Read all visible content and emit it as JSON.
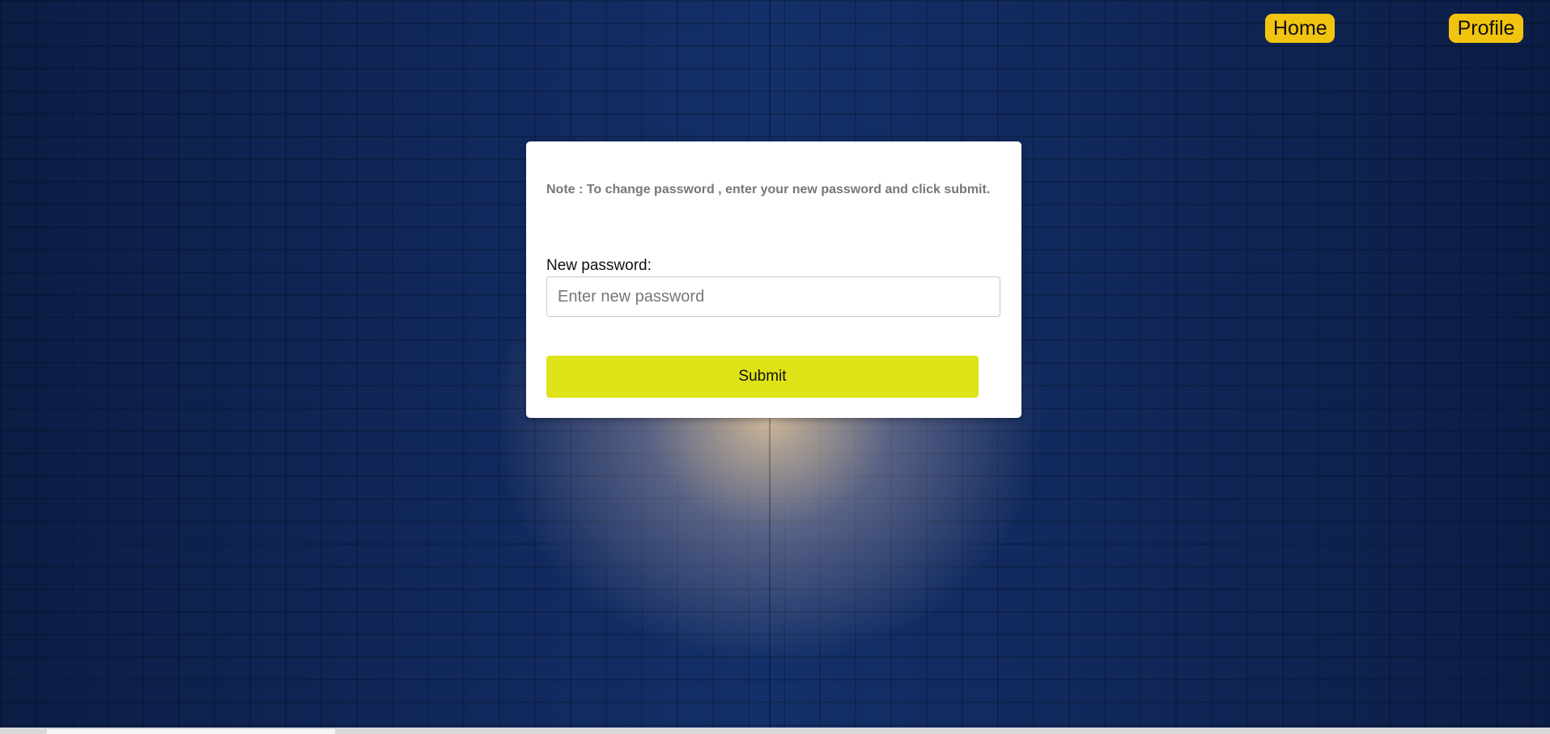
{
  "nav": {
    "home_label": "Home",
    "profile_label": "Profile"
  },
  "form": {
    "note": "Note : To change password , enter your new password and click submit.",
    "new_password_label": "New password:",
    "new_password_placeholder": "Enter new password",
    "new_password_value": "",
    "submit_label": "Submit"
  },
  "colors": {
    "nav_button": "#f1c40f",
    "submit_button": "#dde317",
    "background": "#102552",
    "card": "#ffffff"
  }
}
